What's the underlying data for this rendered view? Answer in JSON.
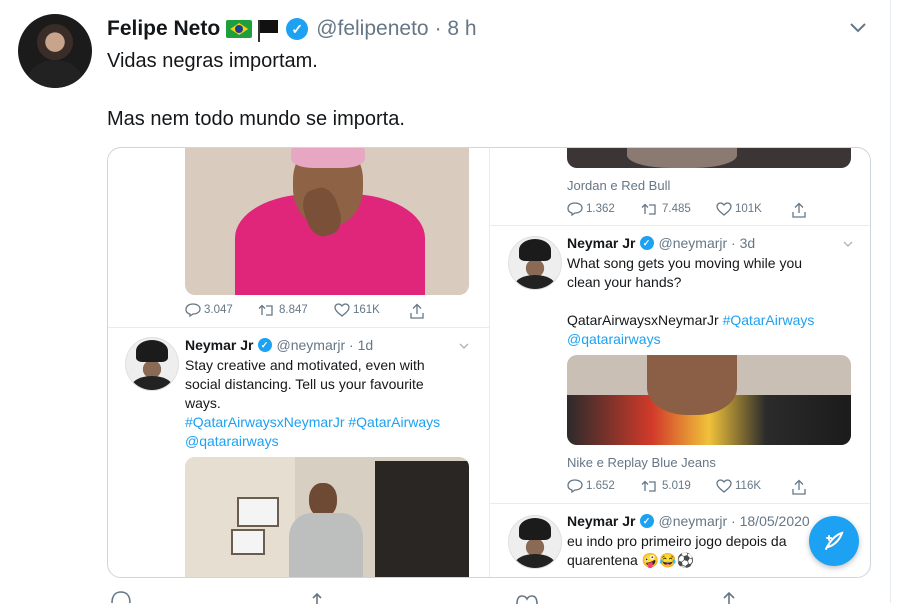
{
  "tweet": {
    "author_name": "Felipe Neto",
    "handle": "@felipeneto",
    "time": "· 8 h",
    "line1": "Vidas negras importam.",
    "line2": "Mas nem todo mundo se importa."
  },
  "embed": {
    "left": {
      "stats1": {
        "replies": "3.047",
        "retweets": "8.847",
        "likes": "161K"
      },
      "tweet": {
        "name": "Neymar Jr",
        "handle": "@neymarjr · 1d",
        "text_l1": "Stay creative and motivated, even with",
        "text_l2": "social distancing. Tell us your favourite",
        "text_l3": "ways.",
        "tags": "#QatarAirwaysxNeymarJr #QatarAirways",
        "mention": "@qatarairways"
      }
    },
    "right": {
      "caption1": "Jordan e Red Bull",
      "stats1": {
        "replies": "1.362",
        "retweets": "7.485",
        "likes": "101K"
      },
      "tweet1": {
        "name": "Neymar Jr",
        "handle": "@neymarjr · 3d",
        "text_l1": "What song gets you moving while you",
        "text_l2": "clean your hands?",
        "plain_tag": "QatarAirwaysxNeymarJr",
        "tag": "#QatarAirways",
        "mention": "@qatarairways"
      },
      "caption2": "Nike e Replay Blue Jeans",
      "stats2": {
        "replies": "1.652",
        "retweets": "5.019",
        "likes": "116K"
      },
      "tweet2": {
        "name": "Neymar Jr",
        "handle": "@neymarjr · 18/05/2020",
        "text_l1": "eu indo pro primeiro jogo depois da",
        "text_l2": "quarentena"
      }
    }
  },
  "colors": {
    "accent": "#1da1f2",
    "muted": "#657786",
    "border": "#ccd6dd",
    "pink_suit": "#e0267a"
  },
  "icons": [
    "chevron-down-icon",
    "verified-icon",
    "reply-icon",
    "retweet-icon",
    "like-icon",
    "share-icon",
    "compose-icon"
  ]
}
